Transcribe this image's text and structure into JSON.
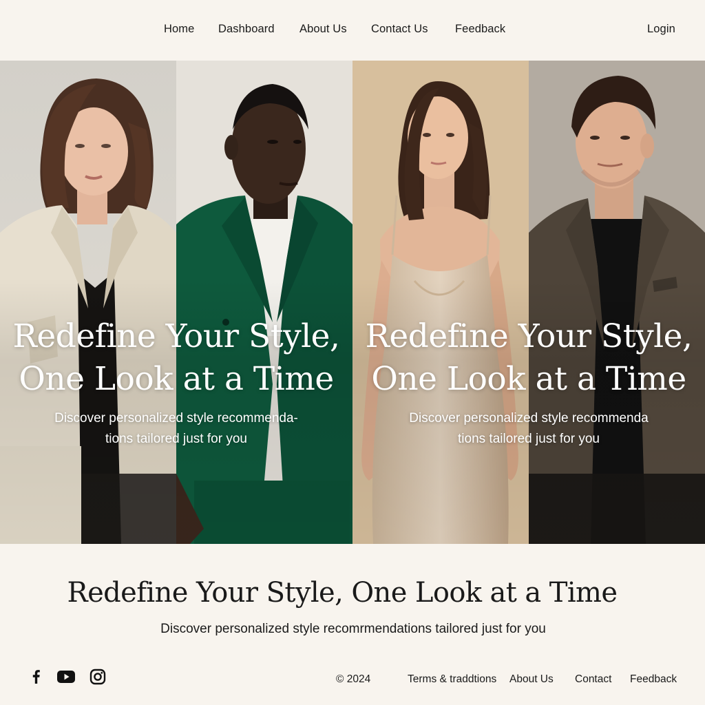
{
  "nav": {
    "links": [
      "Home",
      "Dashboard",
      "About Us",
      "Contact Us",
      "Feedback"
    ],
    "login": "Login"
  },
  "hero": {
    "title_line1": "Redefine Your Style,",
    "title_line2": "One Look at a Time",
    "left_sub_line1": "Discover personalized style recommenda-",
    "left_sub_line2": "tions tailored just for you",
    "right_sub_line1": "Discover personalized style recommenda",
    "right_sub_line2": "tions tailored just for you",
    "panel_colors": [
      "#d9d6cf",
      "#e6e2db",
      "#d7bf9d",
      "#b2aaa0"
    ]
  },
  "section": {
    "title": "Redefine Your Style, One Look at a Time",
    "subtitle": "Discover personalized style recomrmendations tailored just for you"
  },
  "footer": {
    "social_icons": [
      "facebook-icon",
      "youtube-icon",
      "instagram-icon"
    ],
    "copyright": "© 2024",
    "links": [
      "Terms & traddtions",
      "About Us",
      "Contact",
      "Feedback"
    ]
  }
}
